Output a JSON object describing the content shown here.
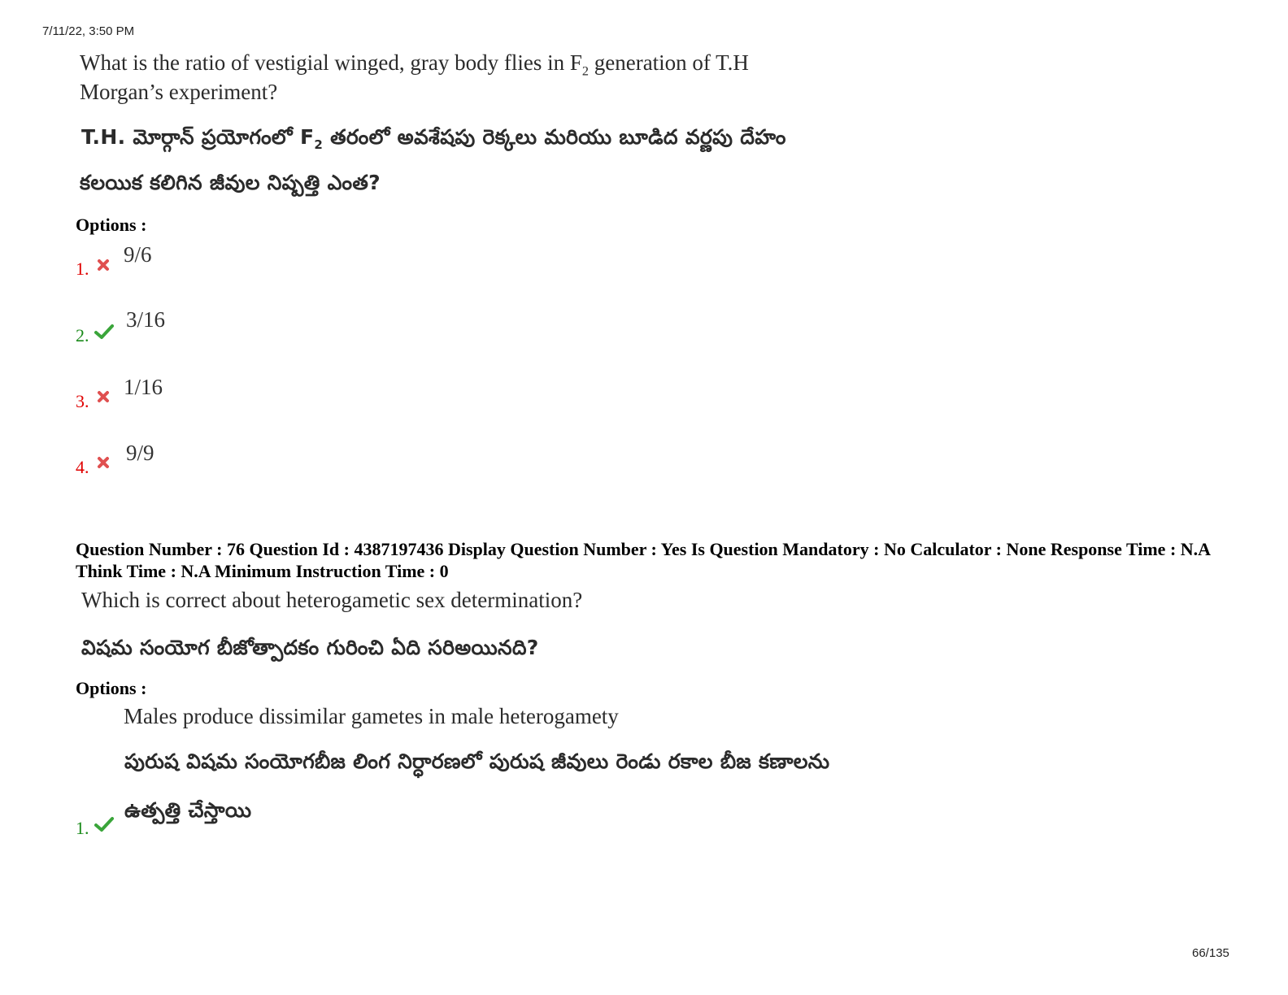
{
  "header": {
    "datetime": "7/11/22, 3:50 PM"
  },
  "q75": {
    "english_line1_a": "What is the ratio of vestigial winged, gray body flies in F",
    "english_line1_sub": "2",
    "english_line1_b": " generation of T.H",
    "english_line2": "Morgan’s experiment?",
    "telugu_line1_a": "T.H. మోర్గాన్ ప్రయోగంలో F",
    "telugu_line1_sub": "2",
    "telugu_line1_b": " తరంలో అవశేషపు రెక్కలు మరియు బూడిద వర్ణపు దేహం",
    "telugu_line2": "కలయిక కలిగిన జీవుల నిష్పత్తి ఎంత?",
    "options_label": "Options :",
    "options": [
      {
        "num": "1.",
        "status": "wrong",
        "value": "9/6"
      },
      {
        "num": "2.",
        "status": "correct",
        "value": "3/16"
      },
      {
        "num": "3.",
        "status": "wrong",
        "value": "1/16"
      },
      {
        "num": "4.",
        "status": "wrong",
        "value": "9/9"
      }
    ]
  },
  "q76": {
    "meta_line": "Question Number : 76 Question Id : 4387197436 Display Question Number : Yes Is Question Mandatory : No Calculator : None Response Time : N.A Think Time : N.A Minimum Instruction Time : 0",
    "english": "Which is correct about heterogametic sex determination?",
    "telugu": "విషమ సంయోగ బీజోత్పాదకం గురించి ఏది సరిఅయినది?",
    "options_label": "Options :",
    "options": [
      {
        "num": "1.",
        "status": "correct",
        "english": "Males produce dissimilar gametes in male heterogamety",
        "telugu_line1": "పురుష విషమ సంయోగబీజ లింగ నిర్ధారణలో పురుష జీవులు రెండు రకాల బీజ కణాలను",
        "telugu_line2": "ఉత్పత్తి చేస్తాయి"
      }
    ]
  },
  "footer": {
    "page": "66/135"
  },
  "colors": {
    "wrong": "#e00000",
    "correct": "#1a8a1a",
    "wrong_icon": "#e05050",
    "correct_icon": "#3aa53a"
  }
}
